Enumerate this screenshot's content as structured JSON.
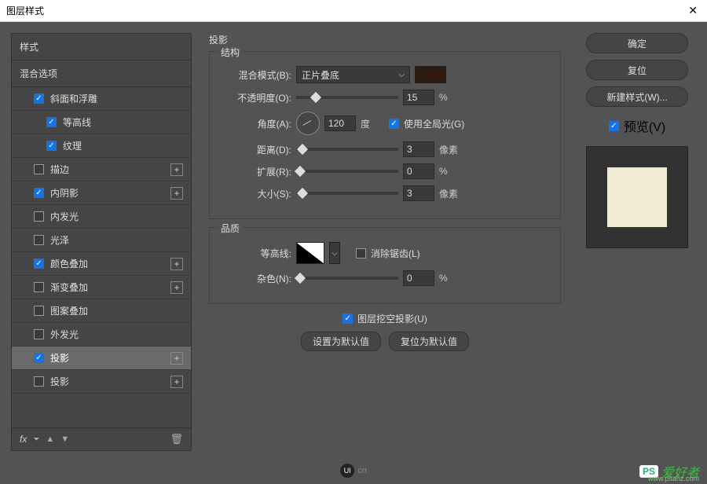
{
  "window": {
    "title": "图层样式"
  },
  "left": {
    "styles_header": "样式",
    "blend_options": "混合选项",
    "items": [
      {
        "label": "斜面和浮雕",
        "checked": true,
        "indent": 1,
        "has_plus": false
      },
      {
        "label": "等高线",
        "checked": true,
        "indent": 2,
        "has_plus": false
      },
      {
        "label": "纹理",
        "checked": true,
        "indent": 2,
        "has_plus": false
      },
      {
        "label": "描边",
        "checked": false,
        "indent": 1,
        "has_plus": true
      },
      {
        "label": "内阴影",
        "checked": true,
        "indent": 1,
        "has_plus": true
      },
      {
        "label": "内发光",
        "checked": false,
        "indent": 1,
        "has_plus": false
      },
      {
        "label": "光泽",
        "checked": false,
        "indent": 1,
        "has_plus": false
      },
      {
        "label": "颜色叠加",
        "checked": true,
        "indent": 1,
        "has_plus": true
      },
      {
        "label": "渐变叠加",
        "checked": false,
        "indent": 1,
        "has_plus": true
      },
      {
        "label": "图案叠加",
        "checked": false,
        "indent": 1,
        "has_plus": false
      },
      {
        "label": "外发光",
        "checked": false,
        "indent": 1,
        "has_plus": false
      },
      {
        "label": "投影",
        "checked": true,
        "indent": 1,
        "has_plus": true,
        "selected": true
      },
      {
        "label": "投影",
        "checked": false,
        "indent": 1,
        "has_plus": true
      }
    ],
    "fx_label": "fx"
  },
  "center": {
    "title": "投影",
    "structure": {
      "legend": "结构",
      "blend_mode_label": "混合模式(B):",
      "blend_mode_value": "正片叠底",
      "swatch_color": "#2e1a0e",
      "opacity_label": "不透明度(O):",
      "opacity_value": "15",
      "opacity_unit": "%",
      "angle_label": "角度(A):",
      "angle_value": "120",
      "angle_unit": "度",
      "global_light_label": "使用全局光(G)",
      "global_light_checked": true,
      "distance_label": "距离(D):",
      "distance_value": "3",
      "distance_unit": "像素",
      "spread_label": "扩展(R):",
      "spread_value": "0",
      "spread_unit": "%",
      "size_label": "大小(S):",
      "size_value": "3",
      "size_unit": "像素"
    },
    "quality": {
      "legend": "品质",
      "contour_label": "等高线:",
      "antialias_label": "消除锯齿(L)",
      "antialias_checked": false,
      "noise_label": "杂色(N):",
      "noise_value": "0",
      "noise_unit": "%"
    },
    "knockout_label": "图层挖空投影(U)",
    "knockout_checked": true,
    "make_default": "设置为默认值",
    "reset_default": "复位为默认值"
  },
  "right": {
    "ok": "确定",
    "cancel": "复位",
    "new_style": "新建样式(W)...",
    "preview_label": "预览(V)",
    "preview_checked": true
  },
  "footer": {
    "ui_cn": "cn",
    "wm_ps": "PS",
    "wm_text": "爱好者",
    "wm_url": "www.psahz.com"
  }
}
